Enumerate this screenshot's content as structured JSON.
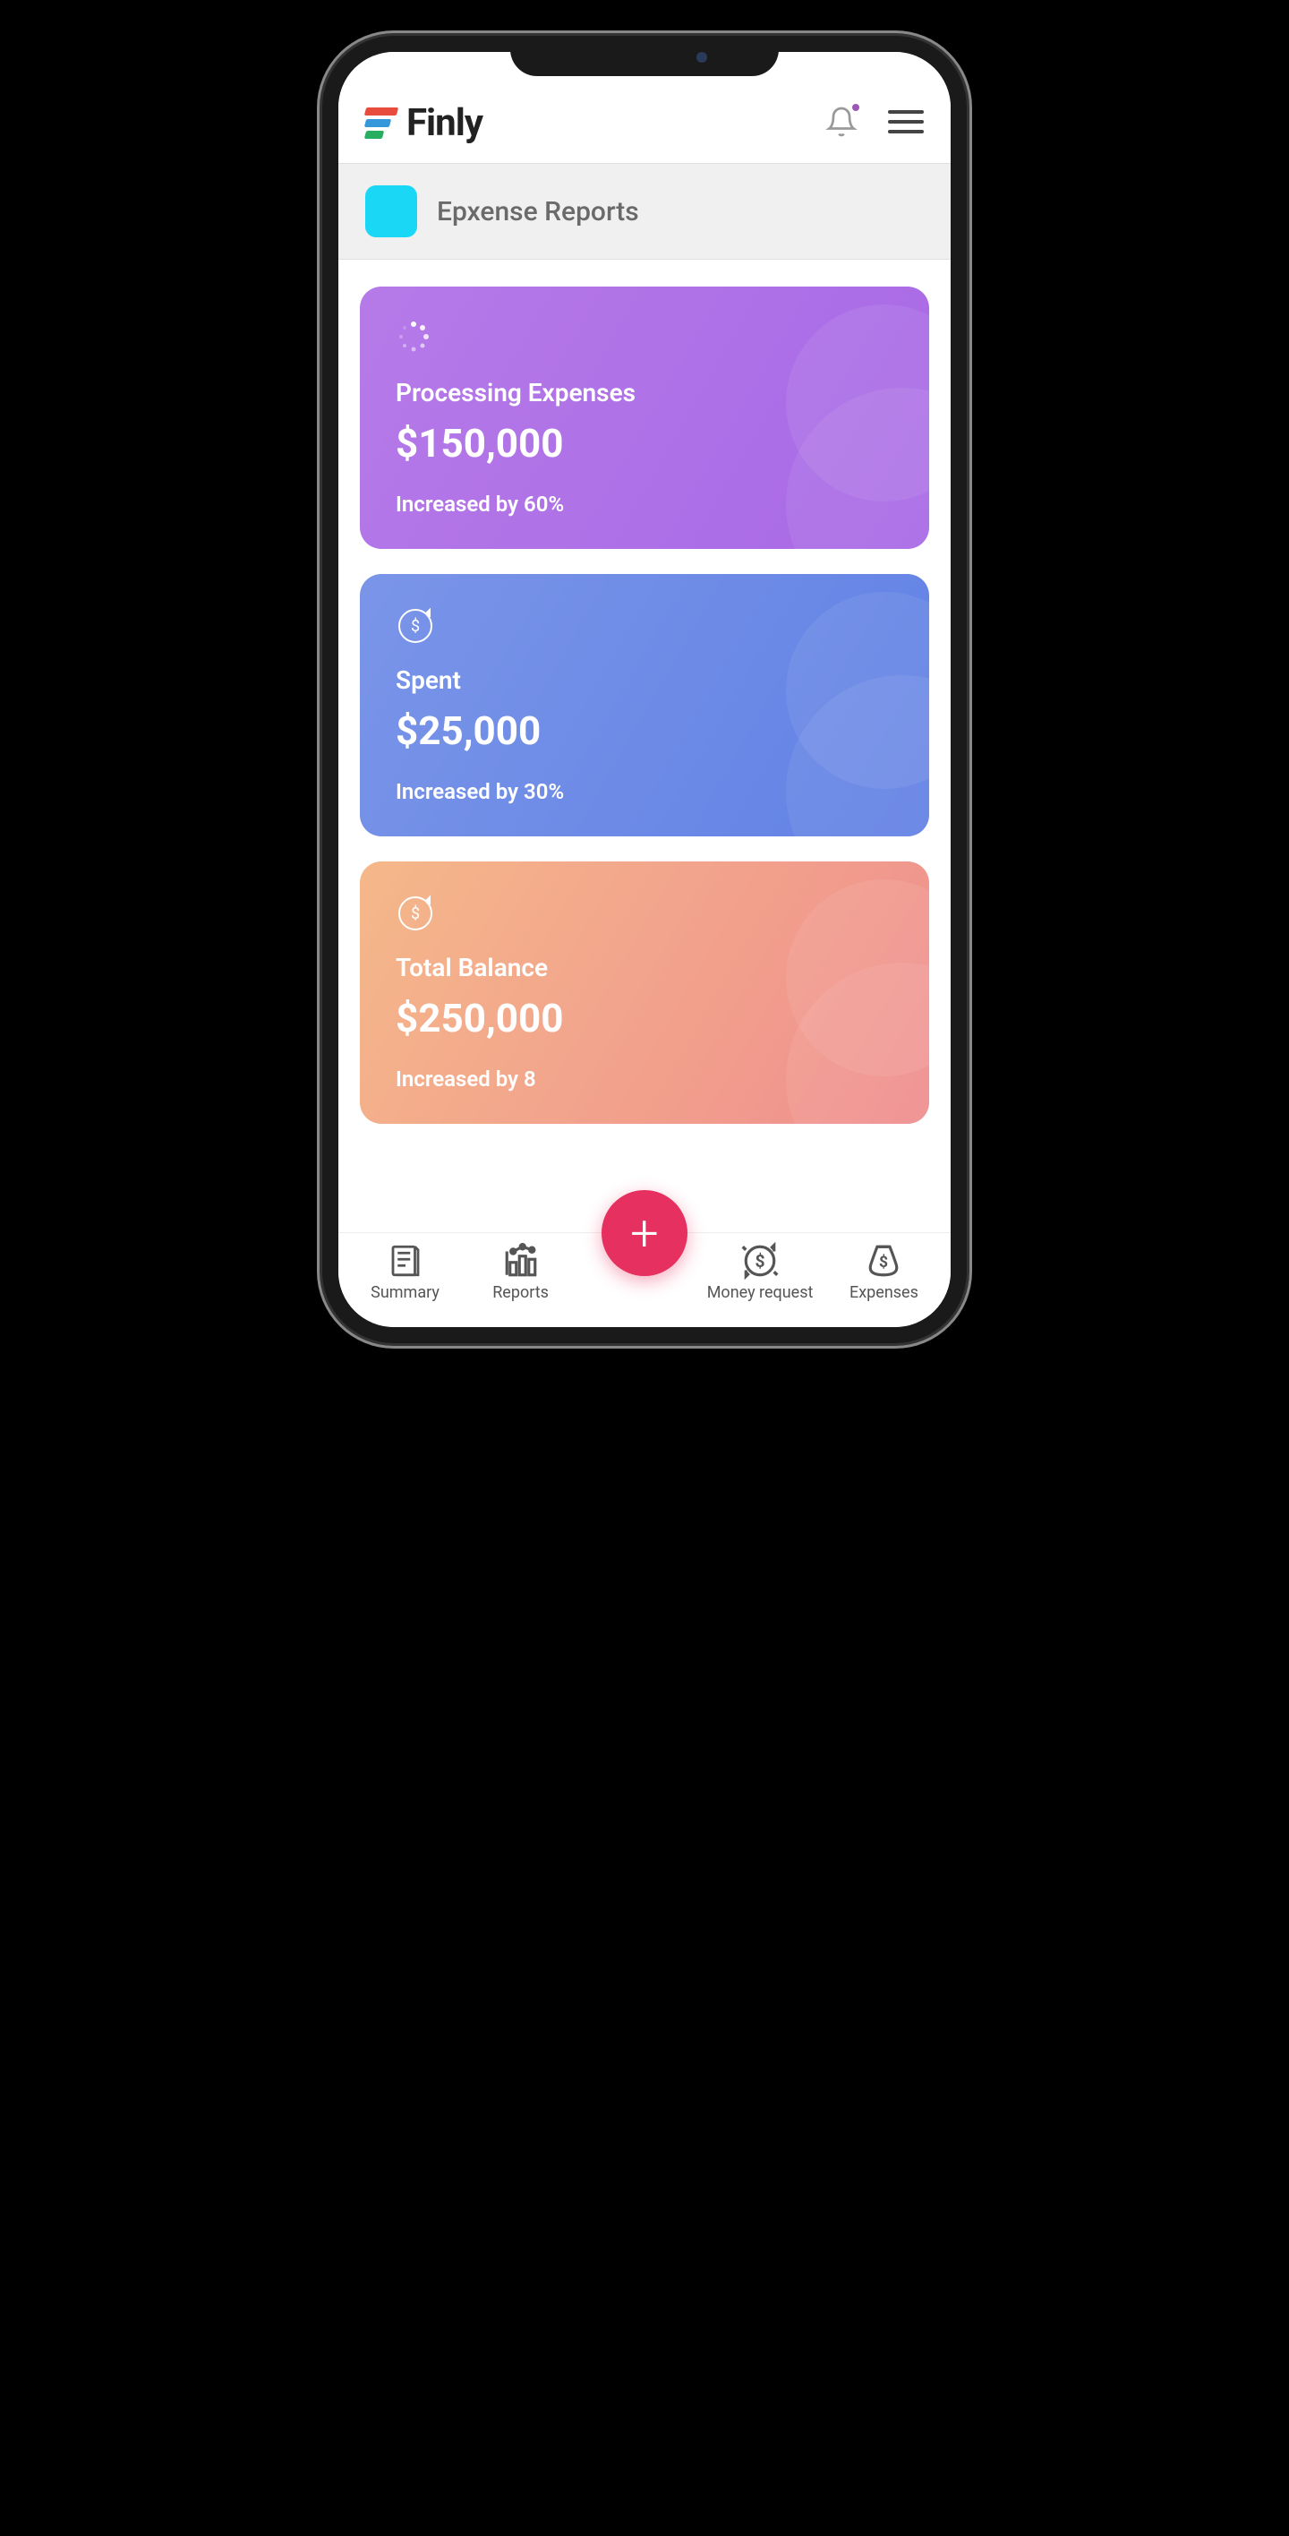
{
  "header": {
    "brand": "Finly"
  },
  "section": {
    "title": "Epxense Reports"
  },
  "cards": [
    {
      "title": "Processing Expenses",
      "amount": "$150,000",
      "change": "Increased by 60%"
    },
    {
      "title": "Spent",
      "amount": "$25,000",
      "change": "Increased by 30%"
    },
    {
      "title": "Total Balance",
      "amount": "$250,000",
      "change": "Increased by 8"
    }
  ],
  "nav": {
    "summary": "Summary",
    "reports": "Reports",
    "money_request": "Money request",
    "expenses": "Expenses"
  }
}
